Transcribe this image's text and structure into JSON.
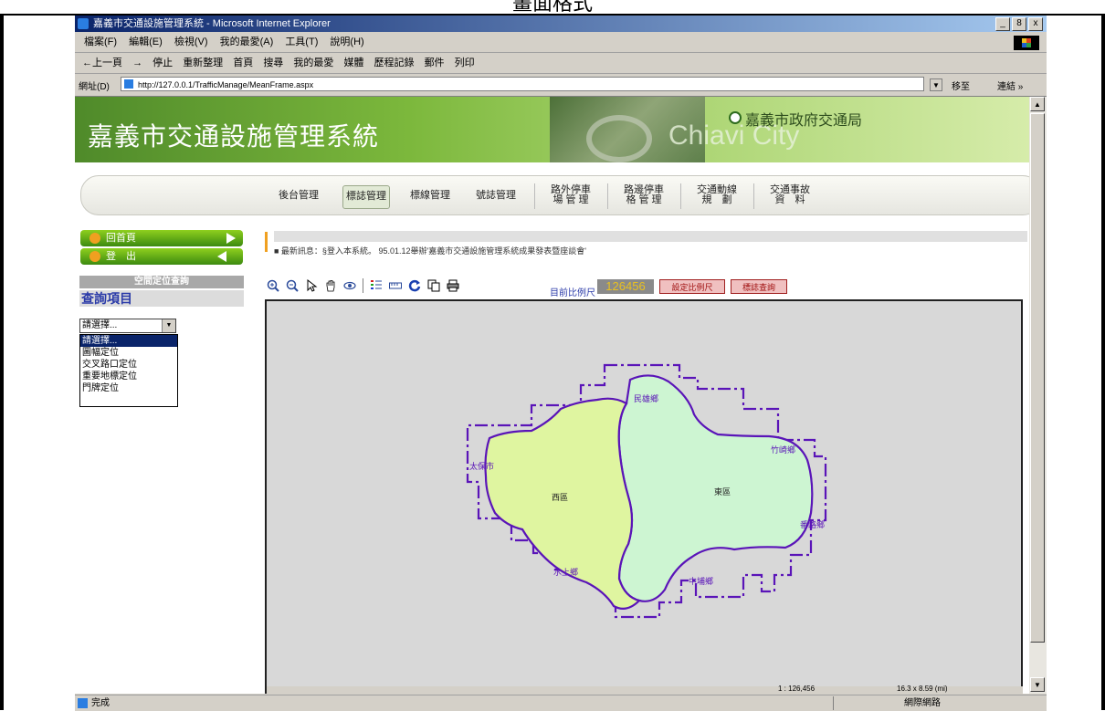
{
  "document_title": "畫面格式",
  "window": {
    "title": "嘉義市交通設施管理系統 - Microsoft Internet Explorer",
    "buttons": [
      "_",
      "8",
      "x"
    ]
  },
  "menu": [
    "檔案(F)",
    "編輯(E)",
    "檢視(V)",
    "我的最愛(A)",
    "工具(T)",
    "說明(H)"
  ],
  "toolbar": [
    "←上一頁",
    "→",
    "停止",
    "重新整理",
    "首頁",
    "搜尋",
    "我的最愛",
    "媒體",
    "歷程記錄",
    "郵件",
    "列印"
  ],
  "address": {
    "label": "網址(D)",
    "url": "http://127.0.0.1/TrafficManage/MeanFrame.aspx",
    "go": "移至",
    "links": "連結 »"
  },
  "banner": {
    "title": "嘉義市交通設施管理系統",
    "department": "嘉義市政府交通局",
    "city_watermark": "Chiavi City"
  },
  "nav": {
    "items": [
      {
        "line1": "後台管理",
        "line2": ""
      },
      {
        "line1": "標誌管理",
        "line2": ""
      },
      {
        "line1": "標線管理",
        "line2": ""
      },
      {
        "line1": "號誌管理",
        "line2": ""
      },
      {
        "line1": "路外停車",
        "line2": "場 管 理"
      },
      {
        "line1": "路邊停車",
        "line2": "格 管 理"
      },
      {
        "line1": "交通動線",
        "line2": "規　劃"
      },
      {
        "line1": "交通事故",
        "line2": "資　料"
      }
    ],
    "active_index": 1
  },
  "sidebar": {
    "home": "回首頁",
    "logout": "登　出",
    "query_header": "空間定位查詢",
    "query_title": "查詢項目",
    "select_value": "請選擇...",
    "options": [
      "請選擇...",
      "圖幅定位",
      "交叉路口定位",
      "重要地標定位",
      "門牌定位"
    ],
    "selected_option": 0
  },
  "news": {
    "text": "■ 最新訊息：§登入本系統。 95.01.12舉辦'嘉義市交通設施管理系統成果發表暨座談會'"
  },
  "map": {
    "tools": [
      "zoom-in",
      "zoom-out",
      "select",
      "pan",
      "eye",
      "legend",
      "measure",
      "refresh",
      "copy",
      "print"
    ],
    "scale_label": "目前比例尺",
    "scale_value": "126456",
    "set_scale_btn": "設定比例尺",
    "sign_query_btn": "標誌查詢",
    "labels": {
      "west": "西區",
      "east": "東區",
      "minxiong": "民雄鄉",
      "taibao": "太保市",
      "zhuqi": "竹崎鄉",
      "fanlu": "番路鄉",
      "shuishang": "水上鄉",
      "zhongpu": "中埔鄉"
    },
    "status_scale": "1 : 126,456",
    "status_size": "16.3 x 8.59 (mi)"
  },
  "status": {
    "text": "完成",
    "zone": "網際網路"
  },
  "colors": {
    "west_district": "#dff5a0",
    "east_district": "#cdf5d2",
    "boundary": "#5a14b8",
    "banner_green": "#7cb83c"
  }
}
